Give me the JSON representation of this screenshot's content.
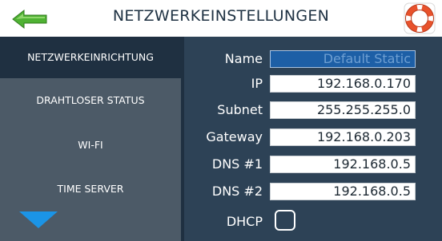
{
  "header": {
    "title": "NETZWERKEINSTELLUNGEN",
    "back_icon": "green-arrow-left",
    "help_icon": "lifebuoy"
  },
  "sidebar": {
    "items": [
      {
        "label": "NETZWERKEINRICHTUNG",
        "active": true
      },
      {
        "label": "DRAHTLOSER STATUS",
        "active": false
      },
      {
        "label": "WI-FI",
        "active": false
      },
      {
        "label": "TIME SERVER",
        "active": false
      }
    ],
    "scroll_down_icon": "triangle-down"
  },
  "form": {
    "name_label": "Name",
    "name_value": "Default Static",
    "ip_label": "IP",
    "ip_value": "192.168.0.170",
    "subnet_label": "Subnet",
    "subnet_value": "255.255.255.0",
    "gateway_label": "Gateway",
    "gateway_value": "192.168.0.203",
    "dns1_label": "DNS #1",
    "dns1_value": "192.168.0.5",
    "dns2_label": "DNS #2",
    "dns2_value": "192.168.0.5",
    "dhcp_label": "DHCP",
    "dhcp_checked": false
  },
  "colors": {
    "panel": "#2d4256",
    "sidebar": "#4c5a67",
    "active_item": "#1f3041",
    "accent_blue": "#1b94e6",
    "name_field": "#1d5fa6"
  }
}
